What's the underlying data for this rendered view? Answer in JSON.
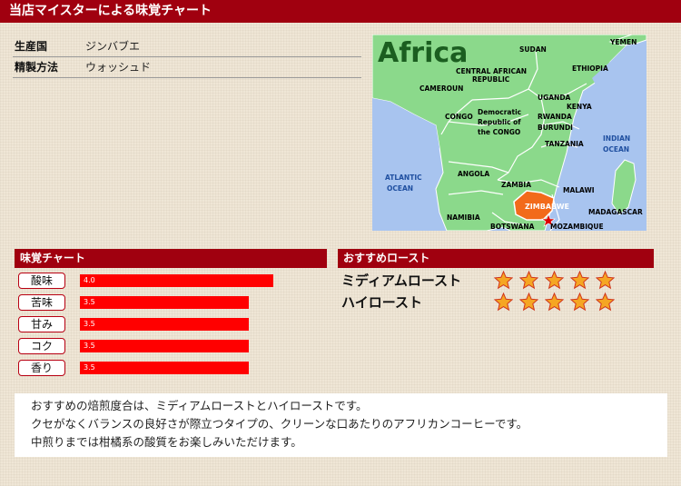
{
  "header": {
    "title": "当店マイスターによる味覚チャート"
  },
  "info": [
    {
      "label": "生産国",
      "value": "ジンバブエ"
    },
    {
      "label": "精製方法",
      "value": "ウォッシュド"
    }
  ],
  "map": {
    "title": "Africa",
    "labels": {
      "yemen": "YEMEN",
      "sudan": "SUDAN",
      "car1": "CENTRAL AFRICAN",
      "car2": "REPUBLIC",
      "ethiopia": "ETHIOPIA",
      "cameroun": "CAMEROUN",
      "uganda": "UGANDA",
      "kenya": "KENYA",
      "drc1": "Democratic",
      "drc2": "Republic of",
      "drc3": "the CONGO",
      "congo": "CONGO",
      "rwanda": "RWANDA",
      "burundi": "BURUNDI",
      "tanzania": "TANZANIA",
      "indian1": "INDIAN",
      "indian2": "OCEAN",
      "atlantic1": "ATLANTIC",
      "atlantic2": "OCEAN",
      "angola": "ANGOLA",
      "zambia": "ZAMBIA",
      "malawi": "MALAWI",
      "zimbabwe": "ZIMBABWE",
      "namibia": "NAMIBIA",
      "madagascar": "MADAGASCAR",
      "botswana": "BOTSWANA",
      "mozambique": "MOZAMBIQUE"
    },
    "colors": {
      "land": "#8bd98b",
      "sea": "#a8c4ef",
      "highlight": "#f26a1a",
      "border": "#ffffff"
    }
  },
  "taste_chart": {
    "heading": "味覚チャート",
    "items": [
      {
        "label": "酸味",
        "value": "4.0",
        "fraction": 0.8
      },
      {
        "label": "苦味",
        "value": "3.5",
        "fraction": 0.7
      },
      {
        "label": "甘み",
        "value": "3.5",
        "fraction": 0.7
      },
      {
        "label": "コク",
        "value": "3.5",
        "fraction": 0.7
      },
      {
        "label": "香り",
        "value": "3.5",
        "fraction": 0.7
      }
    ],
    "bar_color": "#ff0000"
  },
  "roast": {
    "heading": "おすすめロースト",
    "items": [
      {
        "label": "ミディアムロースト",
        "stars": 5
      },
      {
        "label": "ハイロースト",
        "stars": 5
      }
    ],
    "star_color": "#f5a623"
  },
  "comment": {
    "lines": [
      "おすすめの焙煎度合は、ミディアムローストとハイローストです。",
      "クセがなくバランスの良好さが際立つタイプの、クリーンな口あたりのアフリカンコーヒーです。",
      "中煎りまでは柑橘系の酸質をお楽しみいただけます。"
    ]
  }
}
